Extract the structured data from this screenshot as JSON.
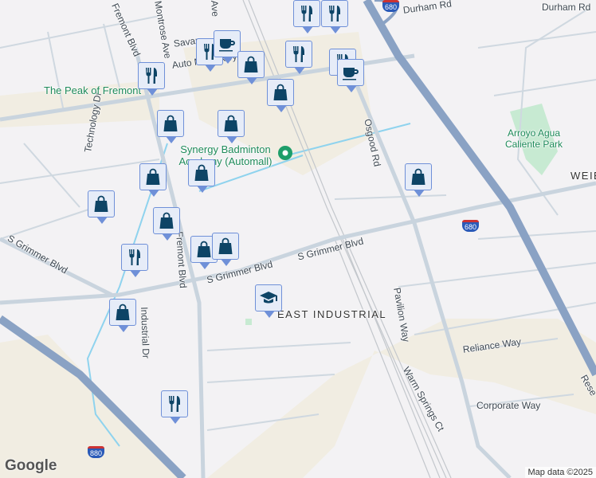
{
  "labels": {
    "fremont_blvd_n": "Fremont Blvd",
    "fremont_blvd_s": "Fremont Blvd",
    "montrose": "Montrose Ave",
    "ave": "Ave",
    "savan": "Savan",
    "auto_mall": "Auto Mall Pkwy",
    "technology": "Technology Dr",
    "osgood": "Osgood Rd",
    "durham1": "Durham Rd",
    "durham2": "Durham Rd",
    "weibel": "WEIBEL",
    "grimmer1": "S Grimmer Blvd",
    "grimmer2": "S Grimmer Blvd",
    "grimmer3": "S Grimmer Blvd",
    "pavilion": "Pavilion Way",
    "industrial_dr": "Industrial Dr",
    "reliance": "Reliance Way",
    "warm_springs": "Warm Springs Ct",
    "corporate": "Corporate Way",
    "rese": "Rese",
    "district": "EAST INDUSTRIAL"
  },
  "pois": {
    "peak": "The Peak of Fremont",
    "synergy": "Synergy Badminton Academy (Automall)",
    "park": "Arroyo Agua Caliente Park"
  },
  "shields": {
    "i680a": "680",
    "i680b": "680",
    "i880": "880"
  },
  "markers": [
    "restaurant",
    "restaurant",
    "coffee",
    "restaurant",
    "restaurant",
    "restaurant",
    "restaurant",
    "coffee",
    "shopping",
    "shopping",
    "shopping",
    "shopping",
    "shopping",
    "shopping",
    "shopping",
    "shopping",
    "shopping",
    "shopping",
    "restaurant",
    "shopping",
    "school",
    "restaurant",
    "shopping"
  ],
  "footer": {
    "logo": "Google",
    "attribution": "Map data ©2025"
  },
  "colors": {
    "marker_icon": "#0d4466",
    "highway": "#8aa2c4",
    "water": "#8fd3ee",
    "park": "#c7ead2",
    "industrial": "#f1ede2"
  }
}
